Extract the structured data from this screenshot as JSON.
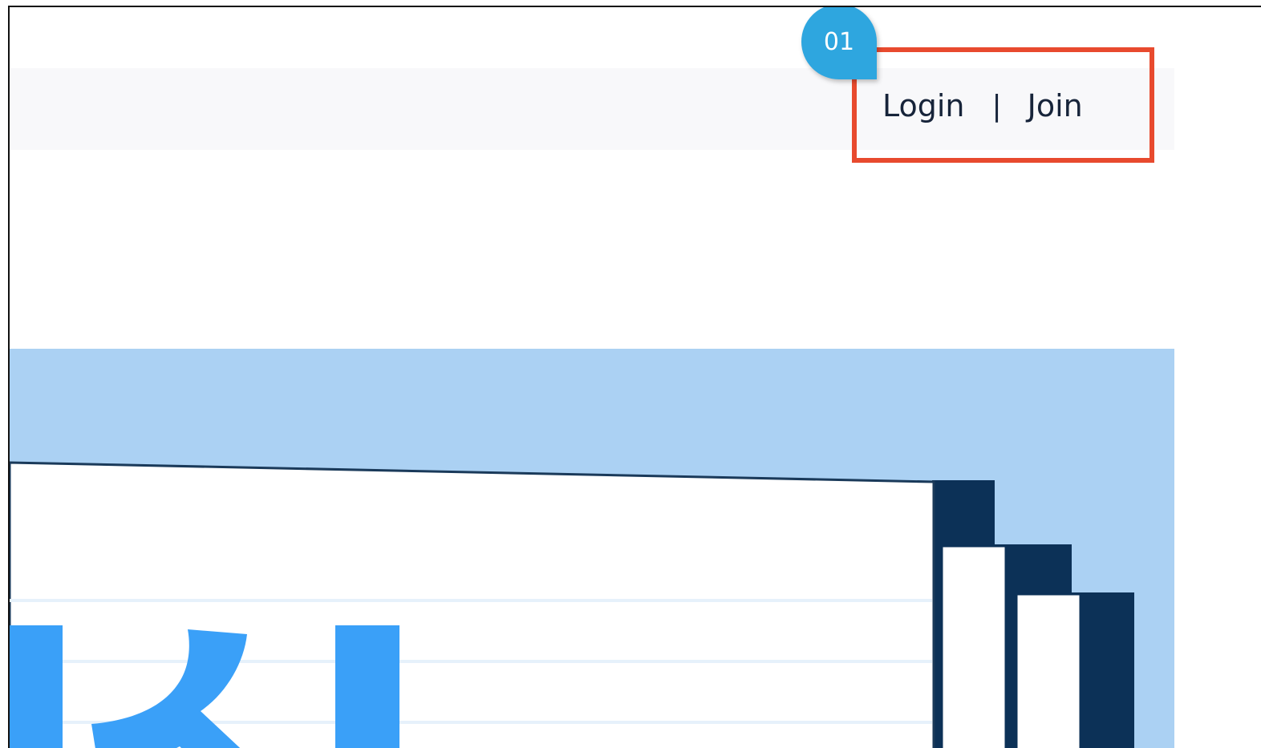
{
  "header": {
    "login_label": "Login",
    "separator": "|",
    "join_label": "Join"
  },
  "annotation": {
    "step_number": "01",
    "highlight_color": "#e84a2e",
    "badge_color": "#2ea6df"
  },
  "banner": {
    "background_color": "#abd1f3",
    "logo_color": "#3aa0f8",
    "illustration_dark_color": "#0c3157"
  }
}
